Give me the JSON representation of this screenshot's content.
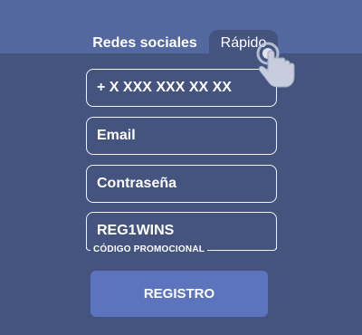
{
  "tabs": {
    "social_label": "Redes sociales",
    "quick_label": "Rápido"
  },
  "form": {
    "phone_placeholder": "+ X XXX XXX XX XX",
    "email_placeholder": "Email",
    "password_placeholder": "Contraseña",
    "promo_value": "REG1WINS",
    "promo_label": "CÓDIGO PROMOCIONAL",
    "register_label": "REGISTRO"
  },
  "icons": {
    "pointer": "tap-hand-icon"
  },
  "colors": {
    "background": "#44547e",
    "top_band": "#5468a0",
    "button": "#5b74bd",
    "border": "#f1f3f8"
  }
}
